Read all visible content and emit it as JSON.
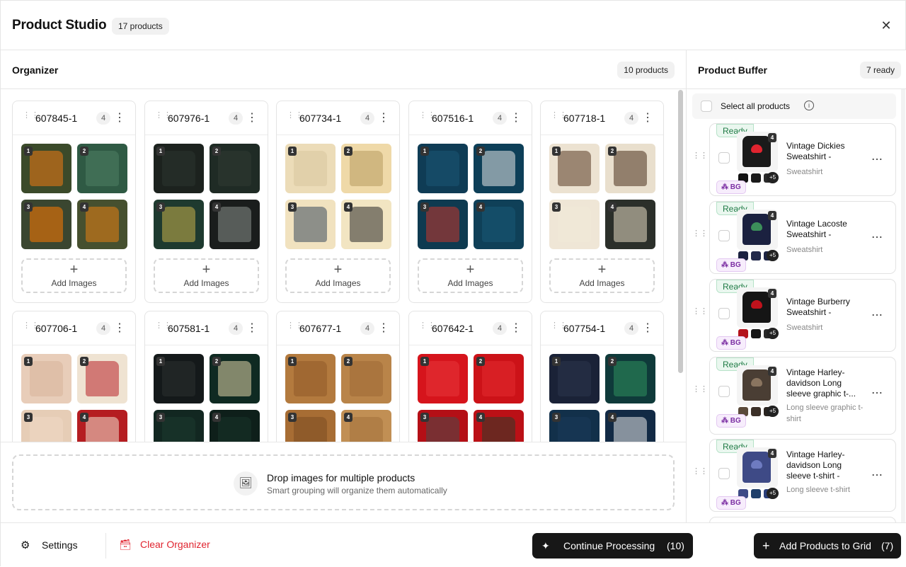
{
  "header": {
    "title": "Product Studio",
    "count_badge": "17 products",
    "close_icon": "close-icon"
  },
  "organizer": {
    "title": "Organizer",
    "count_badge": "10 products",
    "add_images_label": "Add Images",
    "cards": [
      {
        "id": "607845-1",
        "count": "4",
        "colors": [
          "#3b4a2a",
          "#2f5a44",
          "#3a4630",
          "#46502f"
        ],
        "accents": [
          "#f07a12",
          "#4f7f64",
          "#ff7a00",
          "#e87f12"
        ]
      },
      {
        "id": "607976-1",
        "count": "4",
        "colors": [
          "#1c221e",
          "#1f2b25",
          "#1e3a2f",
          "#1a1d1c"
        ],
        "accents": [
          "#2c3530",
          "#2f3b33",
          "#c9b04a",
          "#8b8f8c"
        ]
      },
      {
        "id": "607734-1",
        "count": "4",
        "colors": [
          "#ecdcb8",
          "#efd9a8",
          "#f1e2bf",
          "#f2e5c2"
        ],
        "accents": [
          "#d9c69e",
          "#b79a5f",
          "#3b4b5c",
          "#2a2a2a"
        ]
      },
      {
        "id": "607516-1",
        "count": "4",
        "colors": [
          "#0f3c55",
          "#0d3f58",
          "#0e3a50",
          "#0f4058"
        ],
        "accents": [
          "#1b5575",
          "#e6e6e6",
          "#c7342a",
          "#1a5877"
        ]
      },
      {
        "id": "607718-1",
        "count": "4",
        "colors": [
          "#ece2d1",
          "#e9dfcd",
          "#efe6d6",
          "#2b2f2a"
        ],
        "accents": [
          "#5a3b24",
          "#4b2f1d",
          "#f0ead9",
          "#e5dac3"
        ]
      },
      {
        "id": "607706-1",
        "count": "4",
        "colors": [
          "#e8cdb9",
          "#efe3d2",
          "#e6cdb6",
          "#b51d21"
        ],
        "accents": [
          "#d7b49b",
          "#b82328",
          "#eed9c4",
          "#efe0cf"
        ]
      },
      {
        "id": "607581-1",
        "count": "4",
        "colors": [
          "#14191a",
          "#0f2a22",
          "#122721",
          "#0e1f1a"
        ],
        "accents": [
          "#2a2f30",
          "#e2d3a8",
          "#1b3a30",
          "#17332a"
        ]
      },
      {
        "id": "607677-1",
        "count": "4",
        "colors": [
          "#b37a3e",
          "#b98449",
          "#a76d34",
          "#c18f54"
        ],
        "accents": [
          "#8f5a28",
          "#9e6a34",
          "#7c4d22",
          "#a3713b"
        ]
      },
      {
        "id": "607642-1",
        "count": "4",
        "colors": [
          "#d6141c",
          "#cc1218",
          "#b40f16",
          "#bb1016"
        ],
        "accents": [
          "#e8343a",
          "#e22a2f",
          "#4b4b4b",
          "#2d3a2a"
        ]
      },
      {
        "id": "607754-1",
        "count": "4",
        "colors": [
          "#1a2237",
          "#0f3a3a",
          "#12304a",
          "#122a45"
        ],
        "accents": [
          "#2c344d",
          "#2f8f5c",
          "#1a3a5a",
          "#e6e6e6"
        ]
      }
    ]
  },
  "dropzone": {
    "title": "Drop images for multiple products",
    "subtitle": "Smart grouping will organize them automatically",
    "icon": "image-plus-icon"
  },
  "buffer": {
    "title": "Product Buffer",
    "count_badge": "7 ready",
    "select_all": "Select all products",
    "items": [
      {
        "status": "Ready",
        "name": "Vintage Dickies Sweatshirt -",
        "category": "Sweatshirt",
        "count": "4",
        "more": "+5",
        "badge": "BG",
        "color": "#1a1a1a",
        "accent": "#e0242f",
        "minis": [
          "#111",
          "#1a1a1a",
          "#2b2b2b"
        ]
      },
      {
        "status": "Ready",
        "name": "Vintage Lacoste Sweatshirt -",
        "category": "Sweatshirt",
        "count": "4",
        "more": "+5",
        "badge": "BG",
        "color": "#1b2140",
        "accent": "#3c8f5a",
        "minis": [
          "#1b2140",
          "#22294a",
          "#1d2444"
        ]
      },
      {
        "status": "Ready",
        "name": "Vintage Burberry Sweatshirt -",
        "category": "Sweatshirt",
        "count": "4",
        "more": "+5",
        "badge": "BG",
        "color": "#151515",
        "accent": "#c0121c",
        "minis": [
          "#b4121c",
          "#151515",
          "#2a2a2a"
        ]
      },
      {
        "status": "Ready",
        "name": "Vintage Harley-davidson Long sleeve graphic t-...",
        "category": "Long sleeve graphic t-shirt",
        "count": "4",
        "more": "+5",
        "badge": "BG",
        "color": "#4a3e34",
        "accent": "#8a7560",
        "minis": [
          "#5a4a3a",
          "#3b3028",
          "#2a2420"
        ]
      },
      {
        "status": "Ready",
        "name": "Vintage Harley-davidson Long sleeve t-shirt -",
        "category": "Long sleeve t-shirt",
        "count": "4",
        "more": "+5",
        "badge": "BG",
        "color": "#3e4a86",
        "accent": "#6e7bc0",
        "minis": [
          "#3e4a86",
          "#1f3f6a",
          "#2b3f7a"
        ]
      }
    ]
  },
  "footer": {
    "settings_label": "Settings",
    "clear_label": "Clear Organizer",
    "continue_label": "Continue Processing",
    "continue_count": "(10)",
    "add_label": "Add Products to Grid",
    "add_count": "(7)"
  }
}
